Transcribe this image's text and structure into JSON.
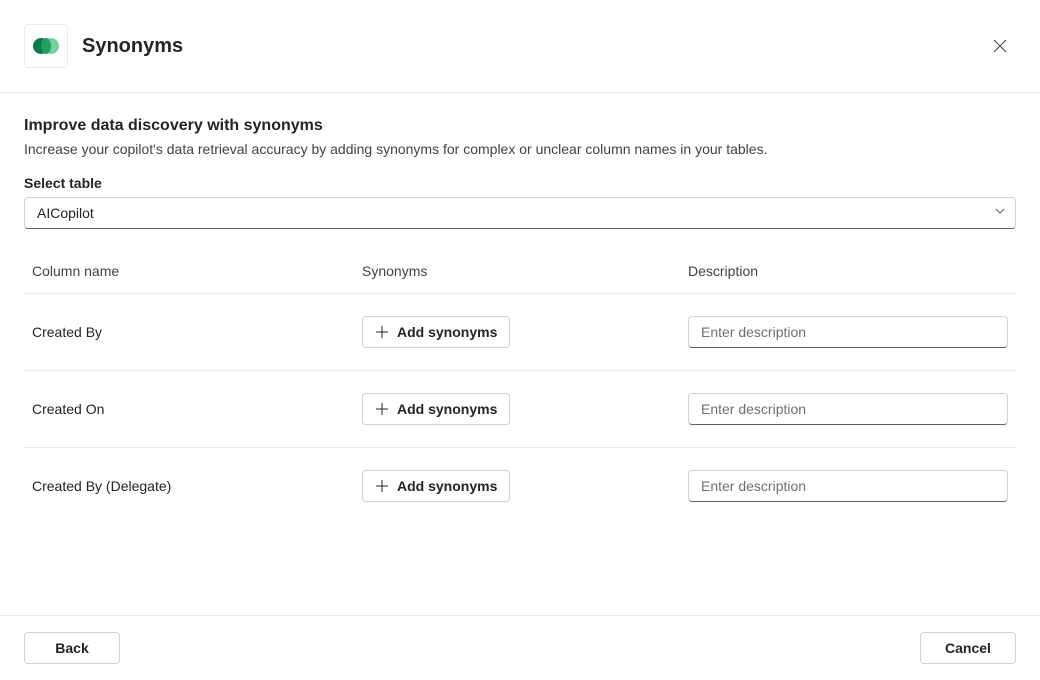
{
  "header": {
    "title": "Synonyms"
  },
  "intro": {
    "heading": "Improve data discovery with synonyms",
    "subheading": "Increase your copilot's data retrieval accuracy by adding synonyms for complex or unclear column names in your tables."
  },
  "select": {
    "label": "Select table",
    "value": "AICopilot"
  },
  "columns": {
    "header_name": "Column name",
    "header_synonyms": "Synonyms",
    "header_description": "Description",
    "add_button_label": "Add synonyms",
    "desc_placeholder": "Enter description",
    "rows": [
      {
        "name": "Created By"
      },
      {
        "name": "Created On"
      },
      {
        "name": "Created By (Delegate)"
      }
    ]
  },
  "footer": {
    "back": "Back",
    "cancel": "Cancel"
  }
}
